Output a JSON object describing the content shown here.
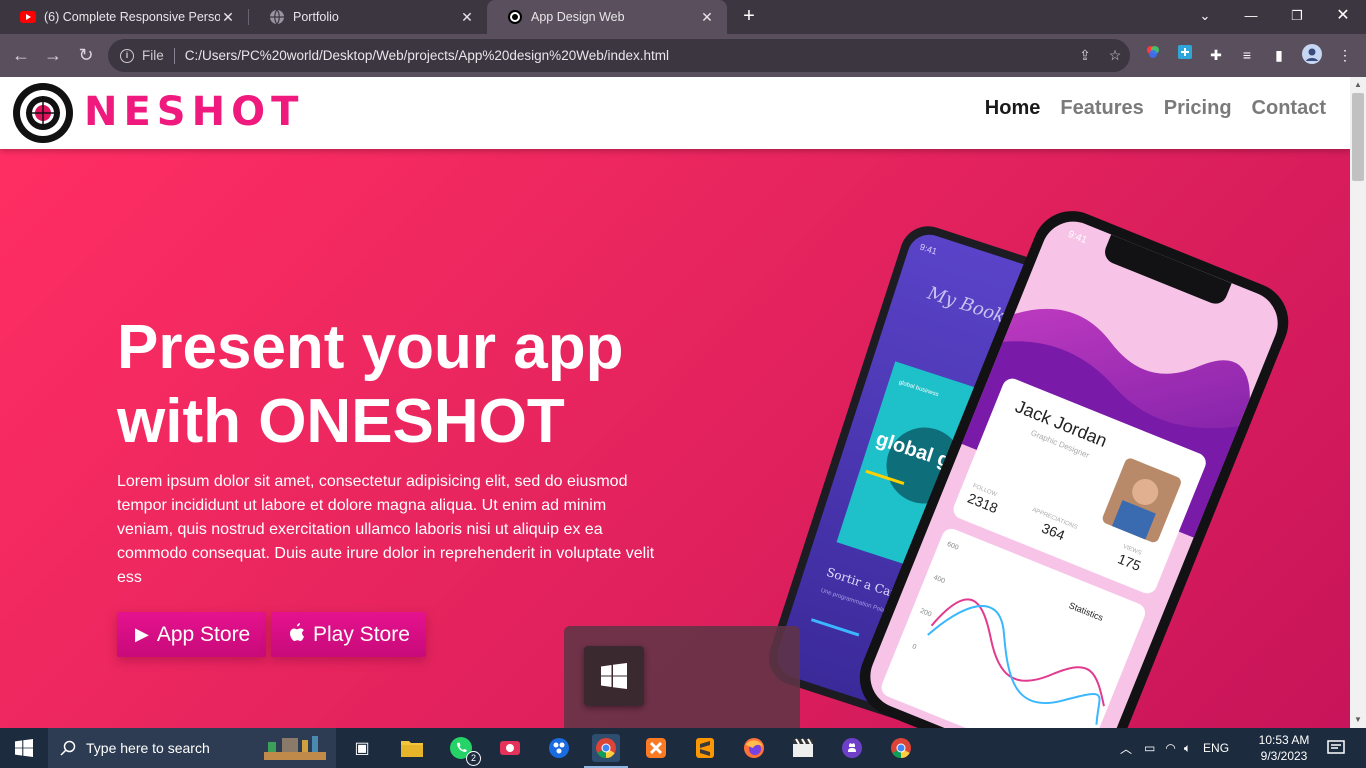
{
  "browser": {
    "tabs": [
      {
        "title": "(6) Complete Responsive Persona",
        "favicon": "youtube-icon",
        "active": false
      },
      {
        "title": "Portfolio",
        "favicon": "globe-icon",
        "active": false
      },
      {
        "title": "App Design Web",
        "favicon": "oneshot-logo-icon",
        "active": true
      }
    ],
    "address_scheme": "File",
    "address_url": "C:/Users/PC%20world/Desktop/Web/projects/App%20design%20Web/index.html"
  },
  "site": {
    "brand": "NESHOT",
    "nav": [
      "Home",
      "Features",
      "Pricing",
      "Contact"
    ],
    "hero": {
      "title_line1": "Present your app",
      "title_line2": "with ONESHOT",
      "body": "Lorem ipsum dolor sit amet, consectetur adipisicing elit, sed do eiusmod tempor incididunt ut labore et dolore magna aliqua. Ut enim ad minim veniam, quis nostrud exercitation ullamco laboris nisi ut aliquip ex ea commodo consequat. Duis aute irure dolor in reprehenderit in voluptate velit ess",
      "app_store_label": "App Store",
      "play_store_label": "Play Store"
    },
    "phone_front": {
      "time": "9:41",
      "name": "Jack Jordan",
      "role": "Graphic Designer",
      "follow_label": "FOLLOW",
      "follow_value": "2318",
      "appreciations_label": "APPRECIATIONS",
      "appreciations_value": "364",
      "views_label": "VIEWS",
      "views_value": "175",
      "stats_title": "Statistics",
      "y_ticks": [
        "600",
        "400",
        "200",
        "0"
      ]
    },
    "phone_back": {
      "time": "9:41",
      "header": "My Books",
      "book_title": "global growth",
      "book_label": "global business",
      "caption": "Sortir a Canne",
      "caption_sub": "Une programmation Pola... festivals et rencontres"
    }
  },
  "taskbar": {
    "search_placeholder": "Type here to search",
    "language": "ENG",
    "time": "10:53 AM",
    "date": "9/3/2023",
    "whatsapp_badge": "2"
  },
  "colors": {
    "accent": "#f0197d",
    "hero_start": "#ff2e63",
    "hero_end": "#c8145a"
  }
}
